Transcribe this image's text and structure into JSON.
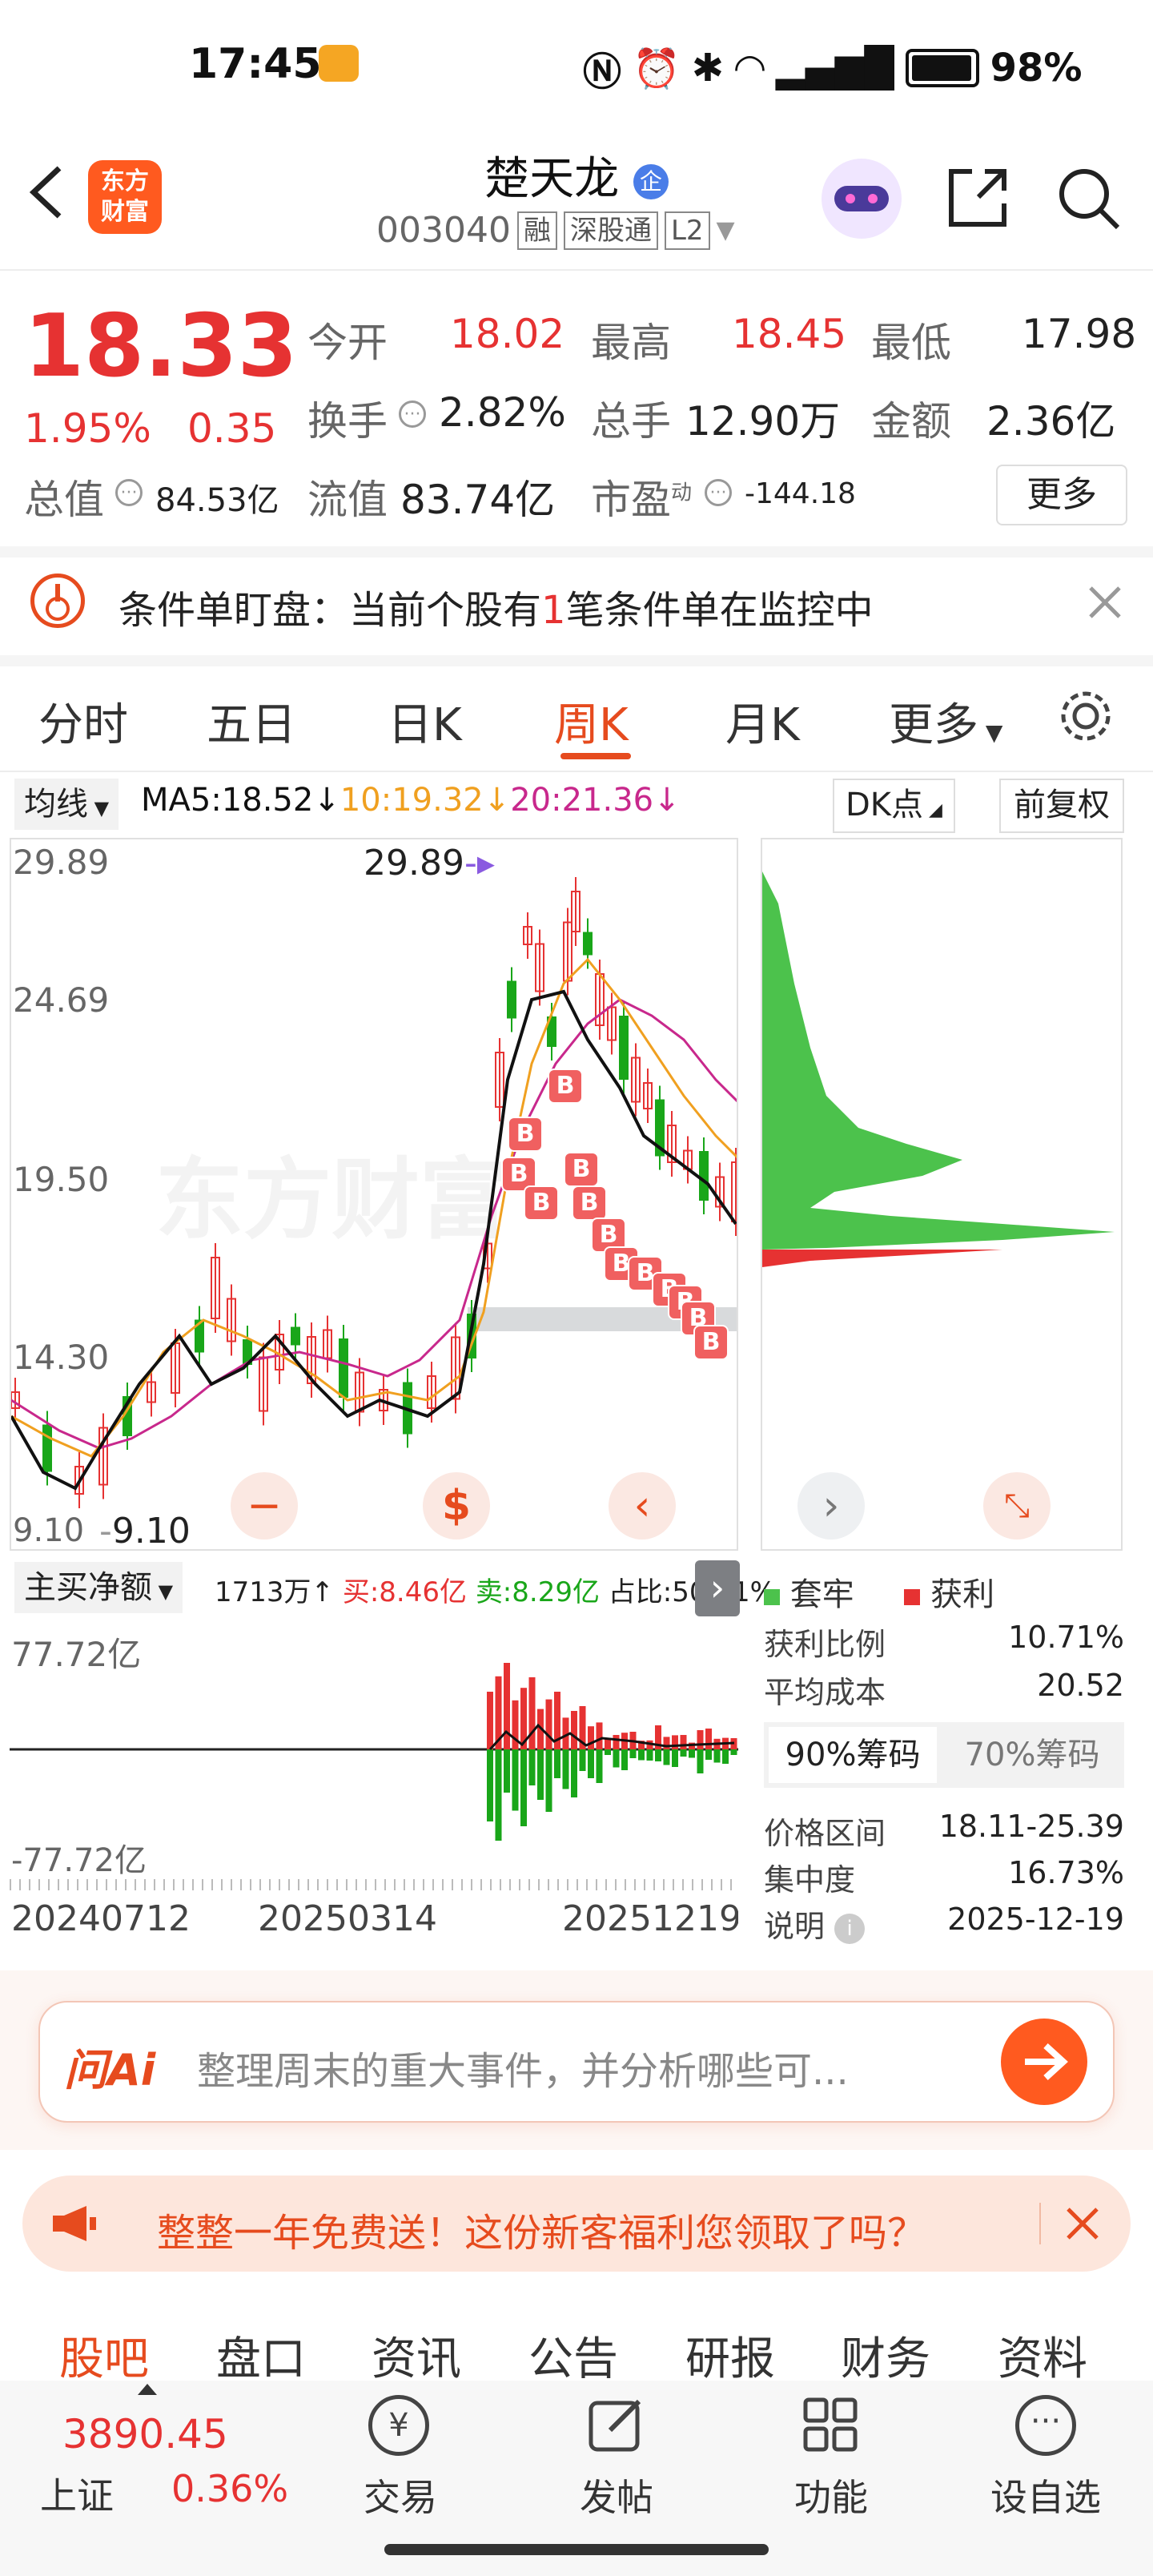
{
  "status_bar": {
    "time": "17:45",
    "battery": "98%"
  },
  "header": {
    "title": "楚天龙",
    "code": "003040",
    "tags": [
      "融",
      "深股通",
      "L2"
    ]
  },
  "quote": {
    "price": "18.33",
    "change_pct": "1.95%",
    "change": "0.35",
    "open_label": "今开",
    "open": "18.02",
    "high_label": "最高",
    "high": "18.45",
    "low_label": "最低",
    "low": "17.98",
    "turnover_label": "换手",
    "turnover": "2.82%",
    "volume_label": "总手",
    "volume": "12.90万",
    "amount_label": "金额",
    "amount": "2.36亿",
    "mcap_label": "总值",
    "mcap": "84.53亿",
    "float_label": "流值",
    "float_mcap": "83.74亿",
    "pe_label": "市盈",
    "pe_sup": "动",
    "pe": "-144.18",
    "more_label": "更多"
  },
  "alert": {
    "text_before": "条件单盯盘：当前个股有",
    "count": "1",
    "text_after": "笔条件单在监控中"
  },
  "tabs": [
    "分时",
    "五日",
    "日K",
    "周K",
    "月K",
    "更多"
  ],
  "active_tab": "周K",
  "ma_bar": {
    "selector": "均线",
    "ma5": "MA5:18.52↓",
    "ma10": "10:19.32↓",
    "ma20": "20:21.36↓",
    "dk_label": "DK点",
    "fq_label": "前复权"
  },
  "colors": {
    "up": "#e63232",
    "down": "#19a619",
    "accent": "#e64b1e",
    "ma5": "#111111",
    "ma10": "#f0a020",
    "ma20": "#c8288c"
  },
  "kline": {
    "y_ticks": [
      "29.89",
      "24.69",
      "19.50",
      "14.30",
      "9.10"
    ],
    "high_mark": "29.89",
    "low_mark": "9.10",
    "watermark": "东方财富"
  },
  "flow": {
    "selector": "主买净额",
    "summary_1": "1713万↑",
    "buy": "买:8.46亿",
    "sell": "卖:8.29亿",
    "ratio": "占比:50.51%",
    "y_top": "77.72亿",
    "y_bottom": "-77.72亿",
    "x_labels": [
      "20240712",
      "20250314",
      "20251219"
    ]
  },
  "chip": {
    "legend_trapped": "套牢",
    "legend_profit": "获利",
    "rows": [
      {
        "label": "获利比例",
        "value": "10.71%"
      },
      {
        "label": "平均成本",
        "value": "20.52"
      }
    ],
    "tabs": [
      "90%筹码",
      "70%筹码"
    ],
    "rows2": [
      {
        "label": "价格区间",
        "value": "18.11-25.39"
      },
      {
        "label": "集中度",
        "value": "16.73%"
      },
      {
        "label": "说明",
        "value": "2025-12-19"
      }
    ]
  },
  "ai": {
    "brand": "问Ai",
    "prompt": "整理周末的重大事件，并分析哪些可..."
  },
  "promo": {
    "text": "整整一年免费送！这份新客福利您领取了吗？"
  },
  "bottom_tabs": [
    "股吧",
    "盘口",
    "资讯",
    "公告",
    "研报",
    "财务",
    "资料"
  ],
  "active_bottom_tab": "股吧",
  "index_ticker": {
    "value": "3890.45",
    "name": "上证",
    "change": "0.36%"
  },
  "bottom_nav": [
    {
      "label": "交易",
      "icon": "trade-icon"
    },
    {
      "label": "发帖",
      "icon": "post-icon"
    },
    {
      "label": "功能",
      "icon": "function-icon"
    },
    {
      "label": "设自选",
      "icon": "add-watchlist-icon"
    }
  ]
}
